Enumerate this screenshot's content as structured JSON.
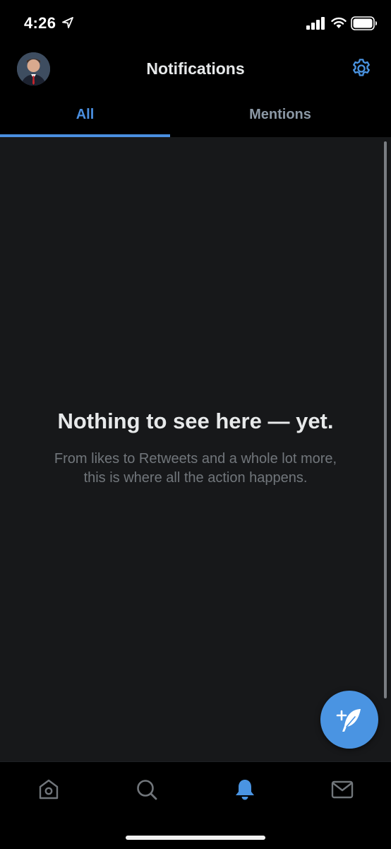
{
  "status_bar": {
    "time": "4:26",
    "location_icon": "location-arrow-icon",
    "signal_icon": "cellular-signal-icon",
    "wifi_icon": "wifi-icon",
    "battery_icon": "battery-icon"
  },
  "header": {
    "title": "Notifications",
    "avatar_icon": "avatar",
    "settings_icon": "gear-icon"
  },
  "tabs": [
    {
      "label": "All",
      "selected": true
    },
    {
      "label": "Mentions",
      "selected": false
    }
  ],
  "empty_state": {
    "title": "Nothing to see here — yet.",
    "body_line1": "From likes to Retweets and a whole lot more,",
    "body_line2": "this is where all the action happens."
  },
  "compose": {
    "icon": "compose-tweet-icon"
  },
  "bottom_nav": [
    {
      "name": "home",
      "icon": "home-icon",
      "active": false
    },
    {
      "name": "search",
      "icon": "search-icon",
      "active": false
    },
    {
      "name": "notifications",
      "icon": "bell-icon",
      "active": true
    },
    {
      "name": "messages",
      "icon": "mail-icon",
      "active": false
    }
  ],
  "colors": {
    "accent": "#4a94e2",
    "background": "#000000",
    "content_background": "#17181a",
    "muted_text": "#71767b"
  }
}
